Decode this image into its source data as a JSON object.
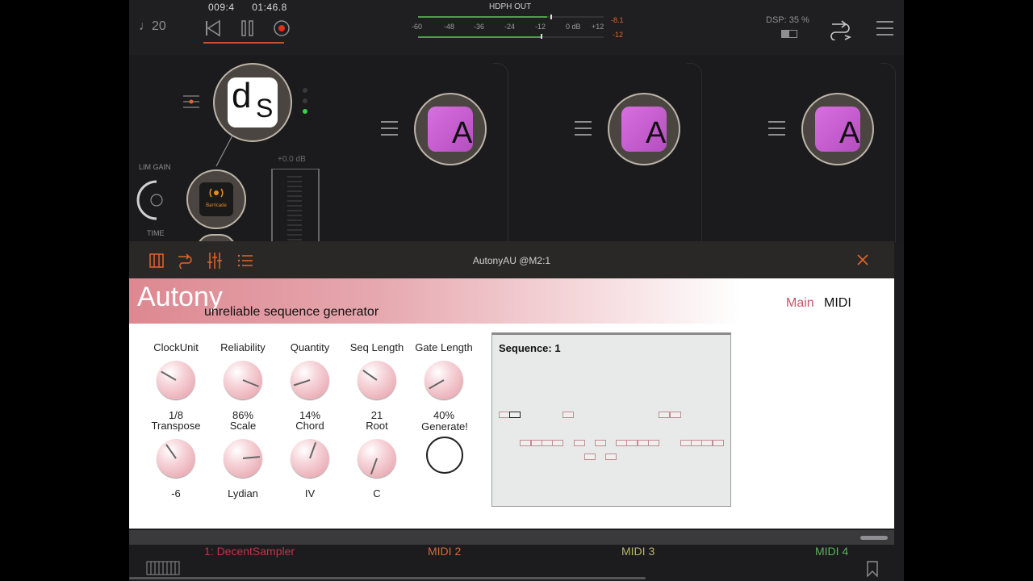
{
  "transport": {
    "tempo": "♩20",
    "position": "009:4",
    "time": "01:46.8"
  },
  "meter": {
    "title": "HDPH OUT",
    "scale": [
      "-60",
      "-48",
      "-36",
      "-24",
      "-12",
      "0 dB",
      "+12"
    ],
    "peak_left": "-8.1",
    "peak_right": "-12",
    "left_level": 0.62,
    "right_level": 0.58
  },
  "dsp": {
    "label": "DSP: 35 %"
  },
  "rack": {
    "limiter_gain_label": "LIM GAIN",
    "time_label": "TIME",
    "fader_value": "+0.0 dB",
    "main_plugin_letters": [
      "d",
      "S"
    ],
    "barricade_label": "Barricade",
    "column_plugin_letter": "A"
  },
  "plugin_window": {
    "title": "AutonyAU @M2:1",
    "brand": "Autony",
    "tagline": "unreliable sequence generator",
    "tabs": [
      {
        "label": "Main",
        "color": "#c2566a"
      },
      {
        "label": "MIDI",
        "color": "#111111"
      }
    ],
    "knobs_row1": [
      {
        "label": "ClockUnit",
        "value": "1/8",
        "angle": -60
      },
      {
        "label": "Reliability",
        "value": "86%",
        "angle": 112
      },
      {
        "label": "Quantity",
        "value": "14%",
        "angle": -108
      },
      {
        "label": "Seq Length",
        "value": "21",
        "angle": -55
      },
      {
        "label": "Gate Length",
        "value": "40%",
        "angle": -120
      }
    ],
    "knobs_row2": [
      {
        "label": "Transpose",
        "value": "-6",
        "angle": -35
      },
      {
        "label": "Scale",
        "value": "Lydian",
        "angle": 85
      },
      {
        "label": "Chord",
        "value": "IV",
        "angle": 20
      },
      {
        "label": "Root",
        "value": "C",
        "angle": -160
      }
    ],
    "generate_label": "Generate!",
    "sequence_title": "Sequence: 1"
  },
  "tracks": [
    {
      "label": "1: DecentSampler",
      "color": "#c0344a"
    },
    {
      "label": "MIDI 2",
      "color": "#d7683a"
    },
    {
      "label": "MIDI 3",
      "color": "#b8b46a"
    },
    {
      "label": "MIDI 4",
      "color": "#5ab25a"
    }
  ]
}
